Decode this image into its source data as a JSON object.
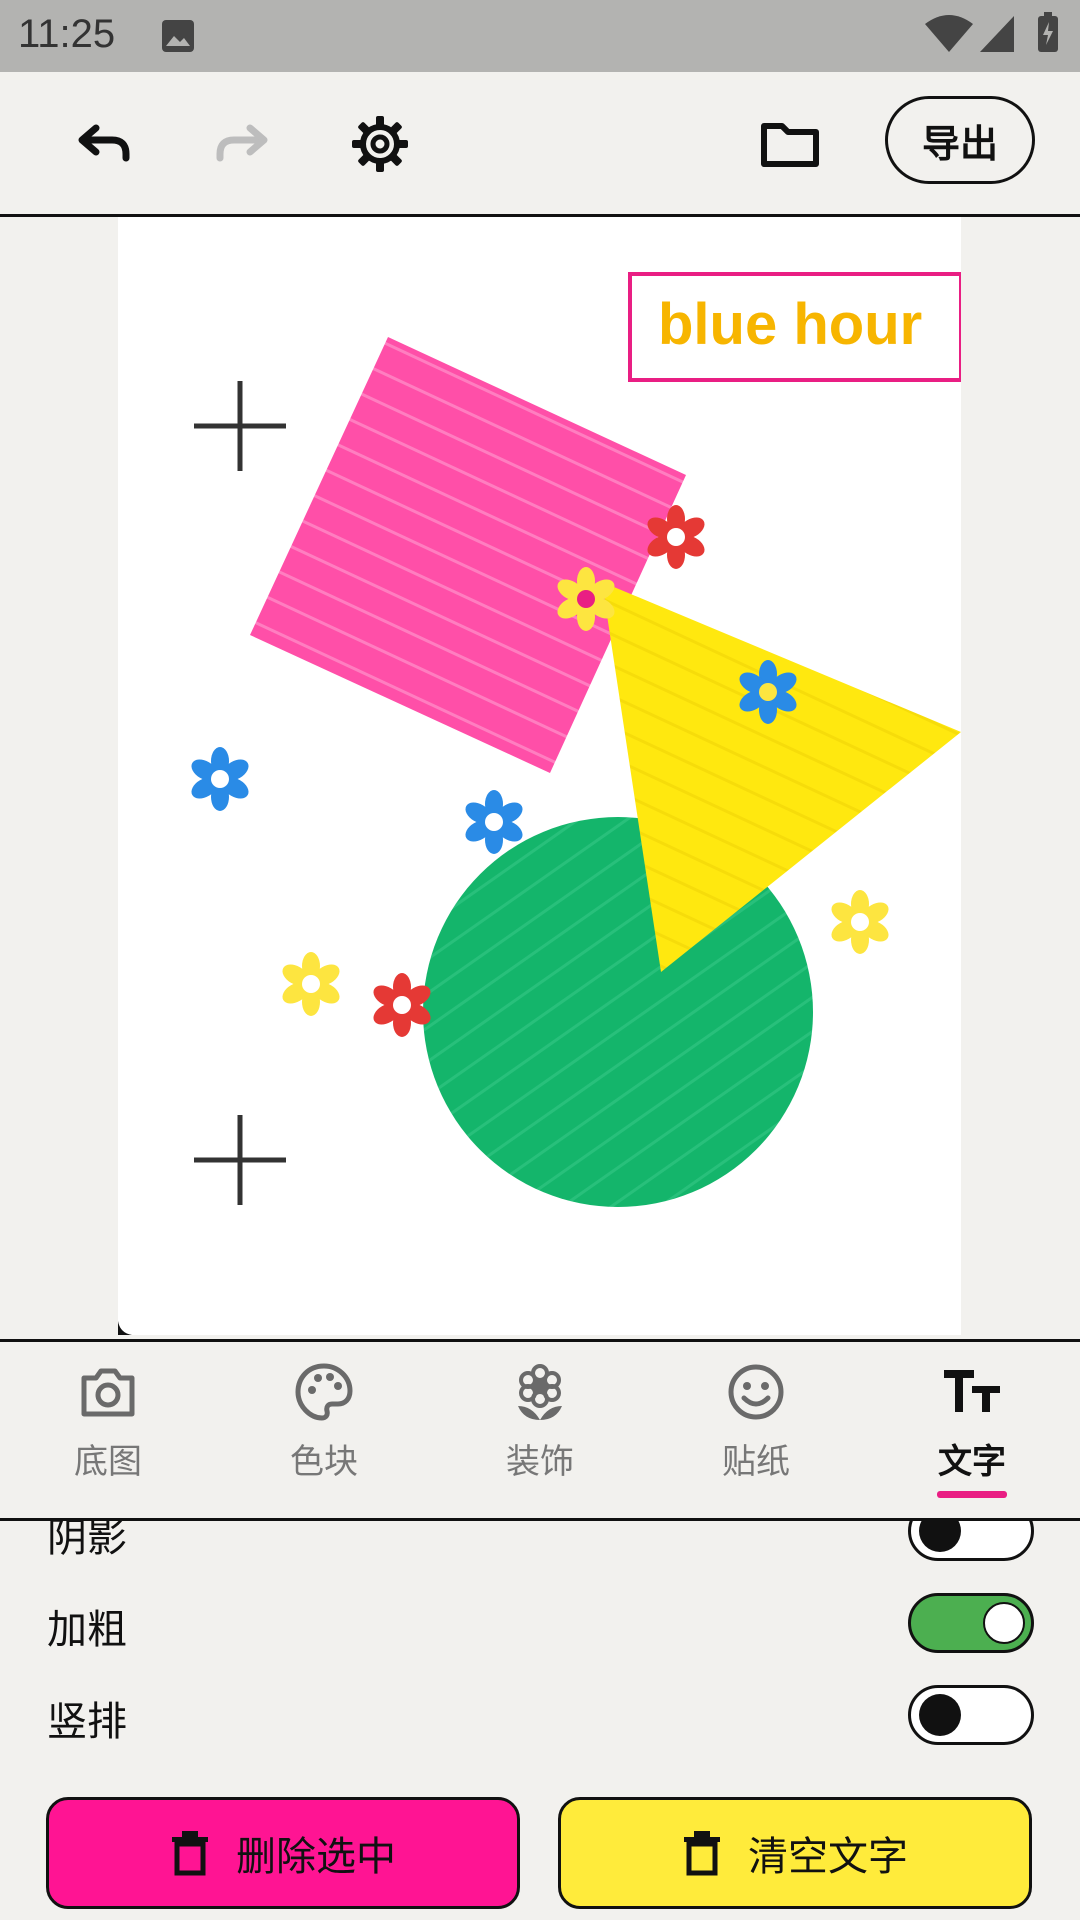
{
  "status_bar": {
    "time": "11:25"
  },
  "toolbar": {
    "export_label": "导出"
  },
  "canvas": {
    "text_layer": "blue hour"
  },
  "tabs": [
    {
      "label": "底图",
      "icon": "camera-icon"
    },
    {
      "label": "色块",
      "icon": "palette-icon"
    },
    {
      "label": "装饰",
      "icon": "flower-icon"
    },
    {
      "label": "贴纸",
      "icon": "smiley-icon"
    },
    {
      "label": "文字",
      "icon": "text-size-icon",
      "active": true
    }
  ],
  "settings": {
    "shadow": {
      "label": "阴影",
      "on": false
    },
    "bold": {
      "label": "加粗",
      "on": true
    },
    "vertical": {
      "label": "竖排",
      "on": false
    }
  },
  "actions": {
    "delete_selected": "删除选中",
    "clear_text": "清空文字"
  },
  "colors": {
    "accent_pink": "#ff1493",
    "accent_yellow": "#ffeb3b",
    "toggle_on": "#4caf50",
    "text_gold": "#f7b500"
  }
}
